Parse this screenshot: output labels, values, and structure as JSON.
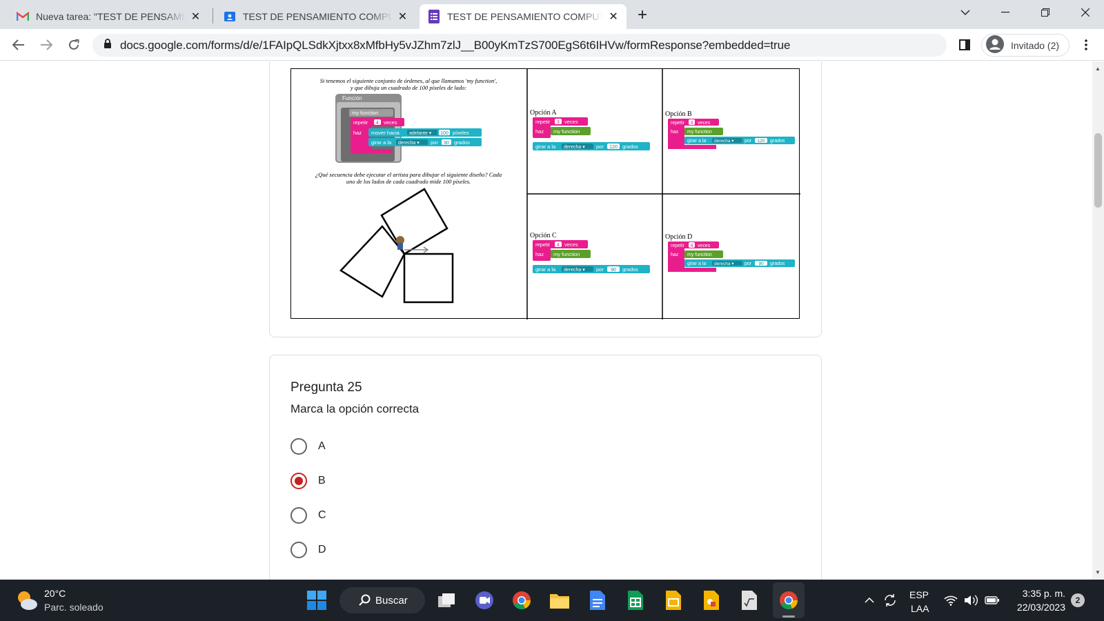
{
  "browser": {
    "tabs": [
      {
        "title": "Nueva tarea: \"TEST DE PENSAMIENTO",
        "icon": "gmail-icon"
      },
      {
        "title": "TEST DE PENSAMIENTO COMPUTACIONAL",
        "icon": "classroom-icon"
      },
      {
        "title": "TEST DE PENSAMIENTO COMPUTACIONAL",
        "icon": "forms-icon",
        "active": true
      }
    ],
    "url": "docs.google.com/forms/d/e/1FAIpQLSdkXjtxx8xMfbHy5vJZhm7zlJ__B00yKmTzS700EgS6t6IHVw/formResponse?embedded=true",
    "profile": "Invitado (2)"
  },
  "figure": {
    "intro_line1": "Si tenemos el siguiente conjunto de órdenes, al que llamamos 'my function',",
    "intro_line2": "y que dibuja un cuadrado de 100 píxeles de lado:",
    "func_header": "Función",
    "func_name": "my function",
    "question_line1": "¿Qué secuencia debe ejecutar el artista para dibujar el siguiente diseño? Cada",
    "question_line2": "uno de los lados de cada cuadrado mide 100 píxeles.",
    "blocks": {
      "repetir": "repetir",
      "veces": "veces",
      "haz": "haz",
      "mover": "mover hacia",
      "adelante": "adelante ▾",
      "pixeles": "píxeles",
      "girar": "girar a la",
      "derecha": "derecha ▾",
      "por": "por",
      "grados": "grados"
    },
    "func_repeat": "4",
    "func_move": "100",
    "func_turn": "90",
    "options": [
      {
        "label": "Opción A",
        "repeat": "3",
        "turn": "120"
      },
      {
        "label": "Opción B",
        "repeat": "3",
        "turn": "120"
      },
      {
        "label": "Opción C",
        "repeat": "4",
        "turn": "90"
      },
      {
        "label": "Opción D",
        "repeat": "4",
        "turn": "90"
      }
    ]
  },
  "question": {
    "title": "Pregunta 25",
    "description": "Marca la opción correcta",
    "options": [
      "A",
      "B",
      "C",
      "D"
    ],
    "selected": "B"
  },
  "taskbar": {
    "weather_temp": "20°C",
    "weather_desc": "Parc. soleado",
    "search_label": "Buscar",
    "lang1": "ESP",
    "lang2": "LAA",
    "time": "3:35 p. m.",
    "date": "22/03/2023",
    "notif_count": "2"
  },
  "colors": {
    "accent": "#c5221f",
    "block_pink": "#e91e8c",
    "block_teal": "#1fb3c7",
    "block_green": "#5ba02b"
  }
}
